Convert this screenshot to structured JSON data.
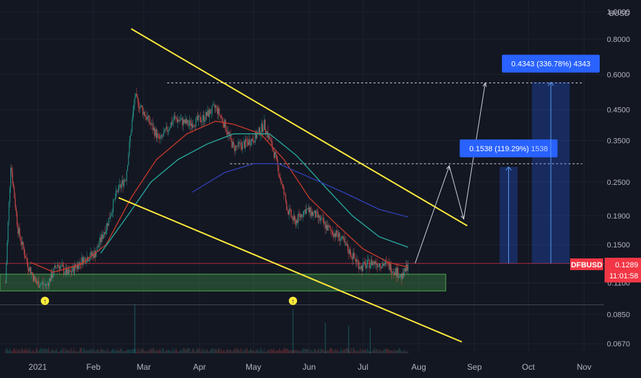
{
  "chart_data": {
    "type": "candlestick",
    "symbol": "DFBUSD",
    "currency": "BUSD",
    "y_scale": "log",
    "ylim": [
      0.062,
      1.1
    ],
    "xlim": [
      "2020-12-11",
      "2021-11-12"
    ],
    "y_ticks": [
      {
        "value": 1.0,
        "label": "1.0000"
      },
      {
        "value": 0.8,
        "label": "0.8000"
      },
      {
        "value": 0.6,
        "label": "0.6000"
      },
      {
        "value": 0.45,
        "label": "0.4500"
      },
      {
        "value": 0.35,
        "label": "0.3500"
      },
      {
        "value": 0.25,
        "label": "0.2500"
      },
      {
        "value": 0.19,
        "label": "0.1900"
      },
      {
        "value": 0.15,
        "label": "0.1500"
      },
      {
        "value": 0.11,
        "label": "0.1100"
      },
      {
        "value": 0.085,
        "label": "0.0850"
      },
      {
        "value": 0.067,
        "label": "0.0670"
      }
    ],
    "x_ticks": [
      {
        "date": "2021-01-01",
        "label": "2021"
      },
      {
        "date": "2021-02-01",
        "label": "Feb"
      },
      {
        "date": "2021-03-01",
        "label": "Mar"
      },
      {
        "date": "2021-04-01",
        "label": "Apr"
      },
      {
        "date": "2021-05-01",
        "label": "May"
      },
      {
        "date": "2021-06-01",
        "label": "Jun"
      },
      {
        "date": "2021-07-01",
        "label": "Jul"
      },
      {
        "date": "2021-08-01",
        "label": "Aug"
      },
      {
        "date": "2021-09-01",
        "label": "Sep"
      },
      {
        "date": "2021-10-01",
        "label": "Oct"
      },
      {
        "date": "2021-11-01",
        "label": "Nov"
      }
    ],
    "last_price": {
      "value": 0.1289,
      "label": "0.1289",
      "countdown": "11:01:58",
      "color": "#f23645"
    },
    "price_path": [
      [
        "2020-12-14",
        0.11
      ],
      [
        "2020-12-17",
        0.29
      ],
      [
        "2020-12-21",
        0.17
      ],
      [
        "2020-12-26",
        0.13
      ],
      [
        "2020-12-31",
        0.11
      ],
      [
        "2021-01-06",
        0.108
      ],
      [
        "2021-01-12",
        0.128
      ],
      [
        "2021-01-18",
        0.118
      ],
      [
        "2021-01-26",
        0.133
      ],
      [
        "2021-02-02",
        0.14
      ],
      [
        "2021-02-09",
        0.18
      ],
      [
        "2021-02-14",
        0.23
      ],
      [
        "2021-02-19",
        0.26
      ],
      [
        "2021-02-24",
        0.5
      ],
      [
        "2021-03-02",
        0.43
      ],
      [
        "2021-03-10",
        0.35
      ],
      [
        "2021-03-18",
        0.42
      ],
      [
        "2021-03-26",
        0.4
      ],
      [
        "2021-04-03",
        0.42
      ],
      [
        "2021-04-10",
        0.46
      ],
      [
        "2021-04-15",
        0.4
      ],
      [
        "2021-04-20",
        0.33
      ],
      [
        "2021-04-26",
        0.34
      ],
      [
        "2021-05-02",
        0.36
      ],
      [
        "2021-05-07",
        0.4
      ],
      [
        "2021-05-13",
        0.31
      ],
      [
        "2021-05-20",
        0.2
      ],
      [
        "2021-05-24",
        0.18
      ],
      [
        "2021-05-30",
        0.2
      ],
      [
        "2021-06-05",
        0.19
      ],
      [
        "2021-06-12",
        0.17
      ],
      [
        "2021-06-18",
        0.16
      ],
      [
        "2021-06-24",
        0.14
      ],
      [
        "2021-06-30",
        0.125
      ],
      [
        "2021-07-06",
        0.13
      ],
      [
        "2021-07-14",
        0.128
      ],
      [
        "2021-07-20",
        0.12
      ],
      [
        "2021-07-23",
        0.115
      ],
      [
        "2021-07-26",
        0.1289
      ]
    ],
    "ema_fast": [
      [
        "2020-12-28",
        0.13
      ],
      [
        "2021-01-10",
        0.12
      ],
      [
        "2021-01-25",
        0.128
      ],
      [
        "2021-02-08",
        0.15
      ],
      [
        "2021-02-22",
        0.22
      ],
      [
        "2021-03-08",
        0.3
      ],
      [
        "2021-03-25",
        0.37
      ],
      [
        "2021-04-10",
        0.41
      ],
      [
        "2021-04-20",
        0.4
      ],
      [
        "2021-05-05",
        0.37
      ],
      [
        "2021-05-18",
        0.3
      ],
      [
        "2021-06-01",
        0.22
      ],
      [
        "2021-06-15",
        0.18
      ],
      [
        "2021-07-01",
        0.145
      ],
      [
        "2021-07-15",
        0.13
      ],
      [
        "2021-07-26",
        0.125
      ]
    ],
    "ema_mid": [
      [
        "2021-02-05",
        0.14
      ],
      [
        "2021-02-20",
        0.19
      ],
      [
        "2021-03-05",
        0.25
      ],
      [
        "2021-03-20",
        0.3
      ],
      [
        "2021-04-05",
        0.34
      ],
      [
        "2021-04-20",
        0.37
      ],
      [
        "2021-05-10",
        0.37
      ],
      [
        "2021-05-25",
        0.31
      ],
      [
        "2021-06-10",
        0.24
      ],
      [
        "2021-06-25",
        0.19
      ],
      [
        "2021-07-10",
        0.16
      ],
      [
        "2021-07-26",
        0.147
      ]
    ],
    "ema_slow": [
      [
        "2021-03-28",
        0.23
      ],
      [
        "2021-04-15",
        0.27
      ],
      [
        "2021-05-01",
        0.29
      ],
      [
        "2021-05-15",
        0.29
      ],
      [
        "2021-06-01",
        0.26
      ],
      [
        "2021-06-20",
        0.23
      ],
      [
        "2021-07-10",
        0.2
      ],
      [
        "2021-07-26",
        0.188
      ]
    ],
    "volume_spikes": [
      [
        "2021-02-24",
        0.9
      ],
      [
        "2021-05-23",
        0.8
      ],
      [
        "2021-06-10",
        0.55
      ],
      [
        "2021-06-23",
        0.5
      ],
      [
        "2021-07-05",
        0.45
      ]
    ],
    "trendlines": [
      {
        "from": [
          "2021-02-22",
          0.87
        ],
        "to": [
          "2021-08-28",
          0.175
        ],
        "color": "#ffeb3b"
      },
      {
        "from": [
          "2021-02-15",
          0.22
        ],
        "to": [
          "2021-08-25",
          0.068
        ],
        "color": "#ffeb3b"
      }
    ],
    "support_zone": {
      "from": "2020-12-11",
      "to": "2021-08-16",
      "top": 0.118,
      "bottom": 0.103,
      "color": "#4caf50"
    },
    "horizontal_lines": [
      {
        "value": 0.56,
        "from": "2021-03-14",
        "to": "2021-10-31",
        "style": "dashed"
      },
      {
        "value": 0.29,
        "from": "2021-04-18",
        "to": "2021-10-31",
        "style": "dashed"
      },
      {
        "value": 0.092,
        "from": "2020-12-11",
        "to": "2021-11-12",
        "style": "solid"
      }
    ],
    "projection_path": [
      [
        "2021-07-30",
        0.129
      ],
      [
        "2021-08-18",
        0.285
      ],
      [
        "2021-08-26",
        0.185
      ],
      [
        "2021-09-07",
        0.56
      ]
    ],
    "measure_boxes": [
      {
        "from": "2021-09-15",
        "to": "2021-09-25",
        "base": 0.1289,
        "target": 0.2827,
        "label": "0.1538 (119.29%) 1538"
      },
      {
        "from": "2021-10-03",
        "to": "2021-10-24",
        "base": 0.1289,
        "target": 0.5632,
        "label": "0.4343 (336.78%) 4343"
      }
    ],
    "markers": [
      {
        "date": "2021-01-05",
        "value": 0.095
      },
      {
        "date": "2021-05-23",
        "value": 0.095
      }
    ]
  }
}
